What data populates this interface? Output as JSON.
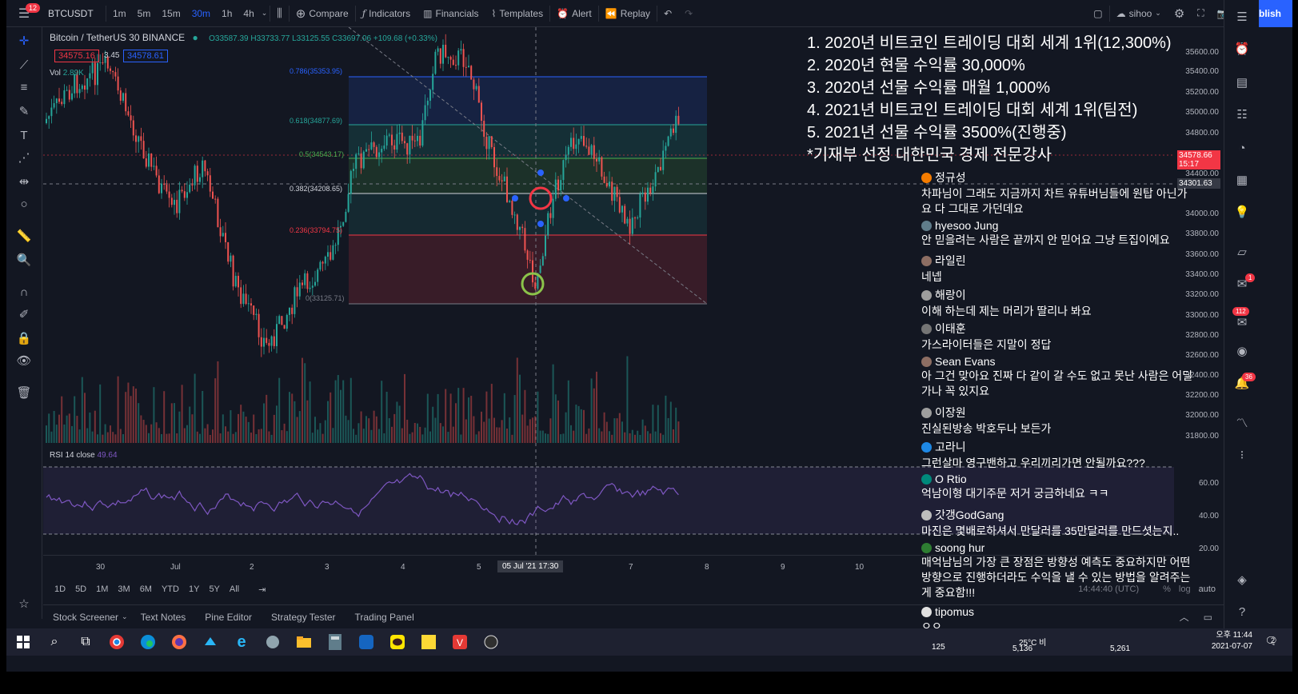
{
  "toolbar": {
    "menu_badge": "12",
    "symbol": "BTCUSDT",
    "timeframes": [
      "1m",
      "5m",
      "15m",
      "30m",
      "1h",
      "4h"
    ],
    "active_timeframe": "30m",
    "compare": "Compare",
    "indicators": "Indicators",
    "financials": "Financials",
    "templates": "Templates",
    "alert": "Alert",
    "replay": "Replay",
    "layout_name": "sihoo",
    "publish": "Publish"
  },
  "legend": {
    "title": "Bitcoin / TetherUS  30  BINANCE",
    "ohlc": "O33587.39 H33733.77 L33125.55 C33697.06 +109.68 (+0.33%)",
    "bid": "34575.16",
    "spread": "3.45",
    "ask": "34578.61",
    "vol_label": "Vol",
    "vol_value": "2.89K",
    "rsi_label": "RSI 14 close",
    "rsi_value": "49.64"
  },
  "fib_levels": [
    {
      "label": "0.786(35353.95)",
      "color": "#2962ff"
    },
    {
      "label": "0.618(34877.69)",
      "color": "#26a69a"
    },
    {
      "label": "0.5(34543.17)",
      "color": "#4caf50"
    },
    {
      "label": "0.382(34208.65)",
      "color": "#d1d4dc"
    },
    {
      "label": "0.236(33794.75)",
      "color": "#f23645"
    },
    {
      "label": "0(33125.71)",
      "color": "#787b86"
    }
  ],
  "price_axis": {
    "ticks": [
      "35600.00",
      "35400.00",
      "35200.00",
      "35000.00",
      "34800.00",
      "34400.00",
      "34000.00",
      "33800.00",
      "33600.00",
      "33400.00",
      "33200.00",
      "33000.00",
      "32800.00",
      "32600.00",
      "32400.00",
      "32200.00",
      "32000.00",
      "31800.00",
      "60.00",
      "40.00",
      "20.00"
    ],
    "current": "34578.66",
    "countdown": "15:17",
    "crosshair": "34301.63"
  },
  "time_axis": {
    "ticks": [
      "30",
      "Jul",
      "2",
      "3",
      "4",
      "5",
      "7",
      "8",
      "9",
      "10"
    ],
    "crosshair": "05 Jul '21   17:30"
  },
  "ranges": [
    "1D",
    "5D",
    "1M",
    "3M",
    "6M",
    "YTD",
    "1Y",
    "5Y",
    "All"
  ],
  "axis_footer": {
    "clock": "14:44:40 (UTC)",
    "percent": "%",
    "log": "log",
    "auto": "auto"
  },
  "bottom_tabs": [
    "Stock Screener",
    "Text Notes",
    "Pine Editor",
    "Strategy Tester",
    "Trading Panel"
  ],
  "overlay_lines": [
    "1. 2020년 비트코인 트레이딩 대회 세계 1위(12,300%)",
    "2. 2020년 현물 수익률 30,000%",
    "3. 2020년 선물 수익률 매월 1,000%",
    "4. 2021년 비트코인 트레이딩 대회 세계 1위(팀전)",
    "5. 2021년 선물 수익률 3500%(진행중)",
    "*기재부 선정 대한민국 경제 전문강사"
  ],
  "chat": [
    {
      "name": "정규성",
      "text": "차파님이 그래도 지금까지 차트 유튜버님들에 원탑 아닌가요 다 그대로 가던데요",
      "color": "#f57c00"
    },
    {
      "name": "hyesoo Jung",
      "text": "안 믿을려는 사람은 끝까지 안 믿어요 그냥 트집이에요",
      "color": "#607d8b"
    },
    {
      "name": "라일린",
      "text": "네넵",
      "color": "#8d6e63"
    },
    {
      "name": "해랑이",
      "text": "이해 하는데 제는 머리가 딸리나 봐요",
      "color": "#9e9e9e"
    },
    {
      "name": "이태훈",
      "text": "가스라이터들은 지말이 정답",
      "color": "#757575"
    },
    {
      "name": "Sean Evans",
      "text": "아 그건 맞아요 진짜 다 같이 갈 수도 없고 못난 사람은 어딜가나 꼭 있지요",
      "color": "#8d6e63"
    },
    {
      "name": "이장원",
      "text": "진실된방송 박호두나 보든가",
      "color": "#9e9e9e"
    },
    {
      "name": "고라니",
      "text": "그런살마 영구밴하고 우리끼리가면 안될까요???",
      "color": "#1e88e5"
    },
    {
      "name": "O Rtio",
      "text": "억남이형 대기주문 저거 궁금하네요 ㅋㅋ",
      "color": "#00897b"
    },
    {
      "name": "갓갱GodGang",
      "text": "마진은 몇배로하셔서 만달러를 35만달러를 만드셧는지..",
      "color": "#bdbdbd"
    },
    {
      "name": "soong hur",
      "text": "매억남님의 가장 큰 장점은 방향성 예측도 중요하지만 어떤 방향으로 진행하더라도 수익을 낼 수 있는 방법을 알려주는게 중요함!!!",
      "color": "#2e7d32"
    },
    {
      "name": "tipomus",
      "text": "ㅇㅇ",
      "color": "#e0e0e0"
    }
  ],
  "right_badges": {
    "chat": "1",
    "notif": "112",
    "alerts": "36"
  },
  "taskbar": {
    "weather": "25°C 비",
    "views_a": "125",
    "views_b": "5,136",
    "views_c": "5,261",
    "time": "오후 11:44",
    "date": "2021-07-07",
    "notif_count": "2"
  }
}
